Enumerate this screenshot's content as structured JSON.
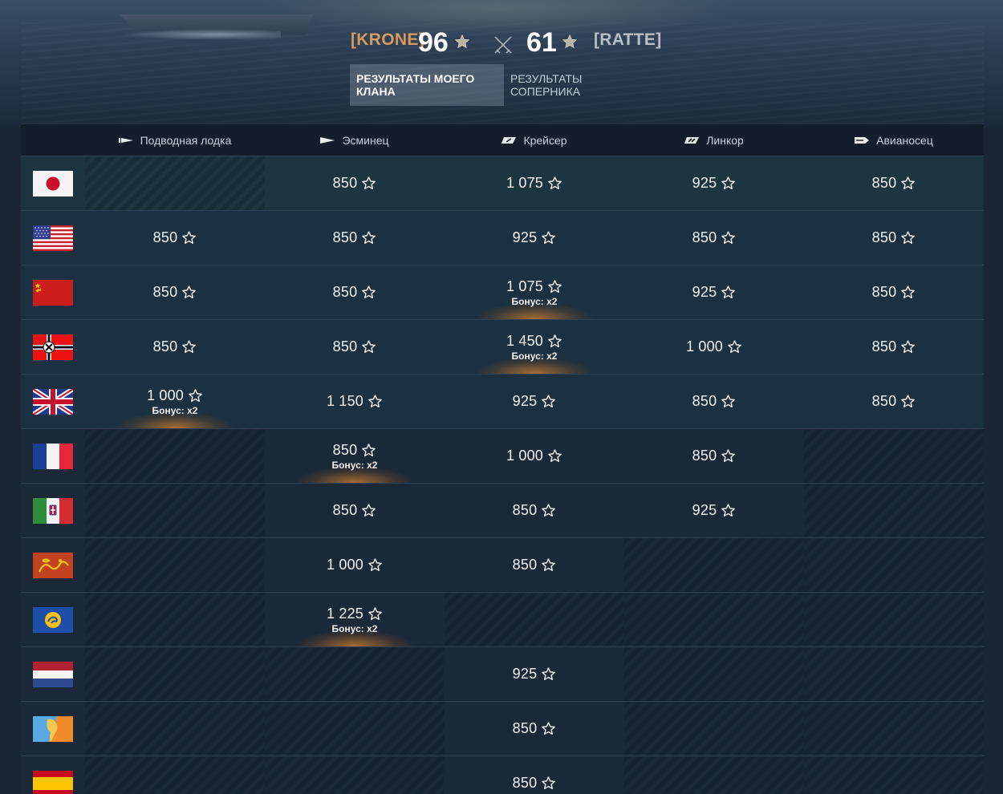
{
  "header": {
    "own_clan_tag": "[KRONE]",
    "own_score": "96",
    "enemy_score": "61",
    "enemy_clan_tag": "[RATTE]",
    "accent_own": "#d69a5c"
  },
  "tabs": [
    {
      "label": "РЕЗУЛЬТАТЫ МОЕГО КЛАНА",
      "active": true
    },
    {
      "label": "РЕЗУЛЬТАТЫ СОПЕРНИКА",
      "active": false
    }
  ],
  "columns": [
    {
      "label": "Подводная лодка",
      "icon": "submarine-icon"
    },
    {
      "label": "Эсминец",
      "icon": "destroyer-icon"
    },
    {
      "label": "Крейсер",
      "icon": "cruiser-icon"
    },
    {
      "label": "Линкор",
      "icon": "battleship-icon"
    },
    {
      "label": "Авианосец",
      "icon": "carrier-icon"
    }
  ],
  "bonus_label": "Бонус: x2",
  "rows": [
    {
      "nation": "japan-flag",
      "cells": [
        null,
        {
          "v": "850"
        },
        {
          "v": "1 075"
        },
        {
          "v": "925"
        },
        {
          "v": "850"
        }
      ]
    },
    {
      "nation": "usa-flag",
      "cells": [
        {
          "v": "850"
        },
        {
          "v": "850"
        },
        {
          "v": "925"
        },
        {
          "v": "850"
        },
        {
          "v": "850"
        }
      ]
    },
    {
      "nation": "ussr-flag",
      "cells": [
        {
          "v": "850"
        },
        {
          "v": "850"
        },
        {
          "v": "1 075",
          "bonus": true
        },
        {
          "v": "925"
        },
        {
          "v": "850"
        }
      ]
    },
    {
      "nation": "germany-flag",
      "cells": [
        {
          "v": "850"
        },
        {
          "v": "850"
        },
        {
          "v": "1 450",
          "bonus": true
        },
        {
          "v": "1 000"
        },
        {
          "v": "850"
        }
      ]
    },
    {
      "nation": "uk-flag",
      "cells": [
        {
          "v": "1 000",
          "bonus": true
        },
        {
          "v": "1 150"
        },
        {
          "v": "925"
        },
        {
          "v": "850"
        },
        {
          "v": "850"
        }
      ]
    },
    {
      "nation": "france-flag",
      "cells": [
        null,
        {
          "v": "850",
          "bonus": true
        },
        {
          "v": "1 000"
        },
        {
          "v": "850"
        },
        null
      ]
    },
    {
      "nation": "italy-flag",
      "cells": [
        null,
        {
          "v": "850"
        },
        {
          "v": "850"
        },
        {
          "v": "925"
        },
        null
      ]
    },
    {
      "nation": "pan-asia-flag",
      "cells": [
        null,
        {
          "v": "1 000"
        },
        {
          "v": "850"
        },
        null,
        null
      ]
    },
    {
      "nation": "commonwealth-flag",
      "cells": [
        null,
        {
          "v": "1 225",
          "bonus": true
        },
        null,
        null,
        null
      ]
    },
    {
      "nation": "netherlands-flag",
      "cells": [
        null,
        null,
        {
          "v": "925"
        },
        null,
        null
      ]
    },
    {
      "nation": "pan-america-flag",
      "cells": [
        null,
        null,
        {
          "v": "850"
        },
        null,
        null
      ]
    },
    {
      "nation": "spain-flag",
      "cells": [
        null,
        null,
        {
          "v": "850"
        },
        null,
        null
      ]
    }
  ]
}
